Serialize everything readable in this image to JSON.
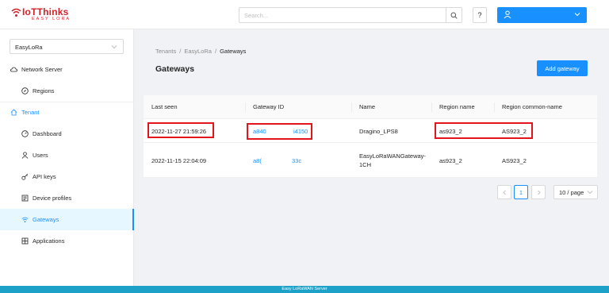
{
  "brand": {
    "logo_main": "IoTThinks",
    "logo_sub": "EASY LORA",
    "color": "#d4202a"
  },
  "header": {
    "search_placeholder": "Search...",
    "help_label": "?",
    "accent": "#1890ff"
  },
  "sidebar": {
    "tenant_selected": "EasyLoRa",
    "network_server": "Network Server",
    "regions": "Regions",
    "tenant": "Tenant",
    "dashboard": "Dashboard",
    "users": "Users",
    "api_keys": "API keys",
    "device_profiles": "Device profiles",
    "gateways": "Gateways",
    "applications": "Applications"
  },
  "breadcrumb": {
    "tenants": "Tenants",
    "tenant": "EasyLoRa",
    "current": "Gateways",
    "separator": "/"
  },
  "page": {
    "title": "Gateways",
    "add_button": "Add gateway"
  },
  "table": {
    "columns": [
      "Last seen",
      "Gateway ID",
      "Name",
      "Region name",
      "Region common-name"
    ],
    "rows": [
      {
        "last_seen": "2022-11-27 21:59:26",
        "gateway_id_start": "a840",
        "gateway_id_end": "i4150",
        "name": "Dragino_LPS8",
        "region_name": "as923_2",
        "region_common": "AS923_2"
      },
      {
        "last_seen": "2022-11-15 22:04:09",
        "gateway_id_start": "a8(",
        "gateway_id_end": "33c",
        "name_line1": "EasyLoRaWANGateway-",
        "name_line2": "1CH",
        "region_name": "as923_2",
        "region_common": "AS923_2"
      }
    ]
  },
  "pagination": {
    "current_page": "1",
    "page_size": "10 / page"
  },
  "footer": {
    "text": "Easy LoRaWAN Server",
    "color": "#1da1c8"
  },
  "highlight_color": "#e3141b"
}
